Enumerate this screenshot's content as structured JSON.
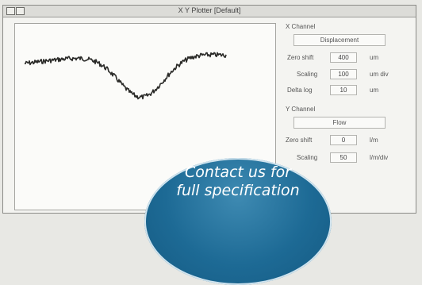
{
  "window": {
    "title": "X Y Plotter [Default]"
  },
  "x_channel": {
    "heading": "X Channel",
    "source": "Displacement",
    "zero_shift": {
      "label": "Zero shift",
      "value": "400",
      "unit": "um"
    },
    "scaling": {
      "label": "Scaling",
      "value": "100",
      "unit": "um div"
    },
    "delta_log": {
      "label": "Delta log",
      "value": "10",
      "unit": "um"
    }
  },
  "y_channel": {
    "heading": "Y Channel",
    "source": "Flow",
    "zero_shift": {
      "label": "Zero shift",
      "value": "0",
      "unit": "l/m"
    },
    "scaling": {
      "label": "Scaling",
      "value": "50",
      "unit": "l/m/div"
    }
  },
  "promo": {
    "line1": "Contact us for",
    "line2": "full specification"
  },
  "colors": {
    "trace": "#2a2a28",
    "promo_bg": "#1d6a95"
  }
}
